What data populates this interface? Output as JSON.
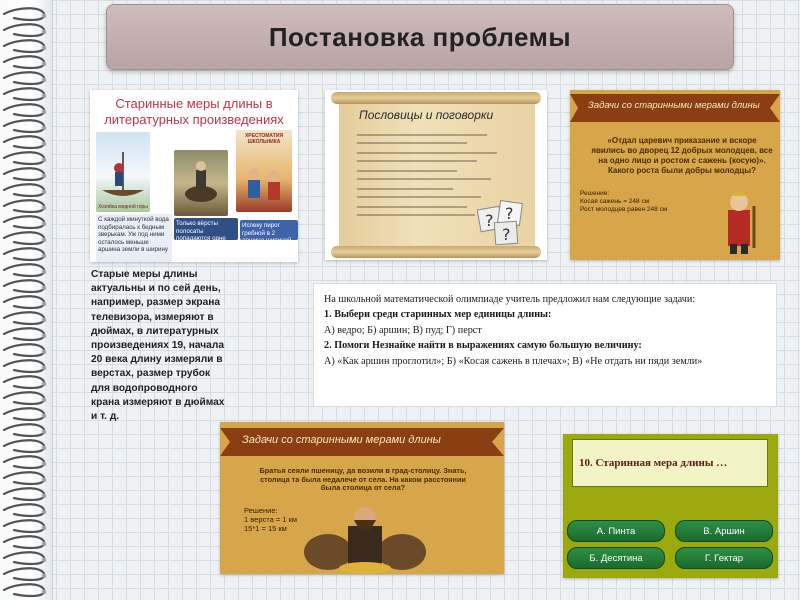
{
  "title": "Постановка проблемы",
  "slides": {
    "literature": {
      "title_line1": "Старинные меры длины в",
      "title_line2": "литературных произведениях",
      "book1_caption": "Хозяйка медной горы",
      "book2_caption": "ХРЕСТОМАТИЯ ШКОЛЬНИКА",
      "caption1": "С каждой минуткой вода подбиралась к бедным зверькам. Уж под ними осталось меньше аршина земли в ширину",
      "caption2": "Только вёрсты полосаты попадаются одне",
      "caption3": "Испеку пирог гребной в 2 аршина шириной"
    },
    "proverbs": {
      "title": "Пословицы и поговорки"
    },
    "task_sazhen": {
      "ribbon": "Задачи со старинными мерами длины",
      "question": "«Отдал царевич приказание и вскоре явились во дворец 12 добрых молодцев, все на одно лицо и ростом с сажень (косую)». Какого роста были добры молодцы?",
      "answer_label": "Решение:",
      "answer_line1": "Косая сажень = 248 см",
      "answer_line2": "Рост молодцев равен 248 см"
    },
    "task_versta": {
      "ribbon": "Задачи со старинными мерами длины",
      "question": "Братья сеяли пшеницу, да возили в град-столицу. Знать, столица та была недалече от села. На каком расстоянии была столица от села?",
      "answer_label": "Решение:",
      "answer_line1": "1 верста = 1 км",
      "answer_line2": "15*1 = 15 км"
    }
  },
  "body_text": "Старые меры длины актуальны и по сей день, например, размер экрана телевизора, измеряют в дюймах, в литературных произведениях 19, начала 20 века длину измеряли в верстах, размер трубок для водопроводного крана измеряют в дюймах и т. д.",
  "olympiad": {
    "intro": "На школьной математической олимпиаде учитель предложил нам следующие задачи:",
    "q1": "1. Выбери среди старинных мер единицы длины:",
    "q1_options": "А) ведро; Б) аршин; В) пуд; Г) перст",
    "q2": "2. Помоги Незнайке найти в выражениях самую большую величину:",
    "q2_options": "А) «Как аршин проглотил»; Б) «Косая сажень в плечах»; В) «Не отдать ни пяди земли»"
  },
  "quiz": {
    "question": "10. Старинная мера длины …",
    "options": [
      {
        "label": "А. Пинта"
      },
      {
        "label": "В. Аршин"
      },
      {
        "label": "Б. Десятина"
      },
      {
        "label": "Г. Гектар"
      }
    ]
  },
  "colors": {
    "title_bar": "#bfa9a9",
    "parchment": "#d8a64a",
    "quiz_bg": "#9ba80e",
    "quiz_button": "#2a8a40",
    "literature_title": "#b8344b"
  }
}
